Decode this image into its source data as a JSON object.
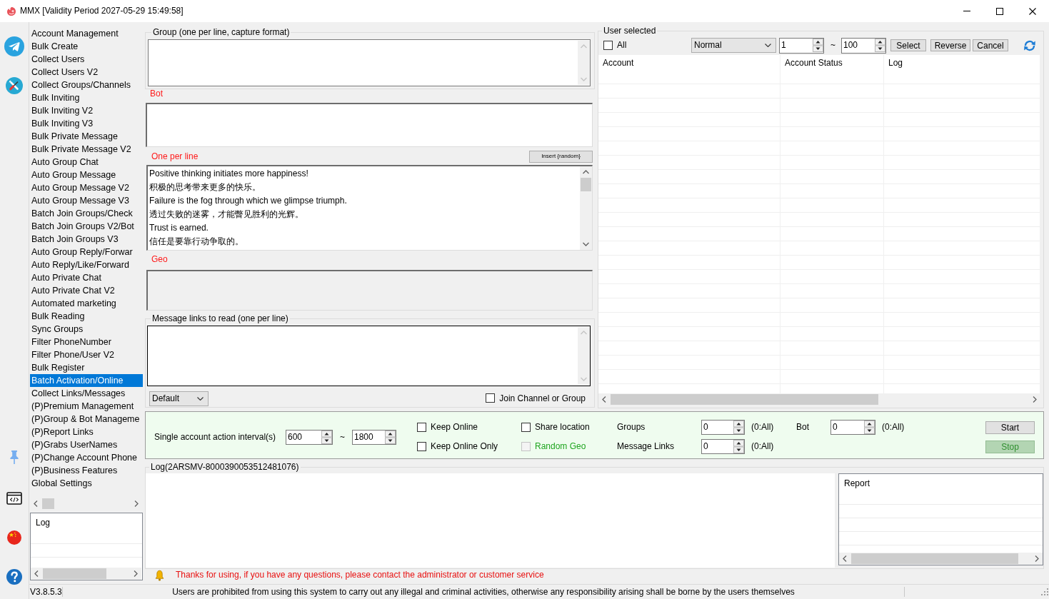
{
  "window": {
    "title": "MMX [Validity Period 2027-05-29 15:49:58]"
  },
  "menu": {
    "items": [
      {
        "label": "Account Management",
        "selected": false
      },
      {
        "label": "Bulk Create",
        "selected": false
      },
      {
        "label": "Collect Users",
        "selected": false
      },
      {
        "label": "Collect Users V2",
        "selected": false
      },
      {
        "label": "Collect Groups/Channels",
        "selected": false
      },
      {
        "label": "Bulk Inviting",
        "selected": false
      },
      {
        "label": "Bulk Inviting V2",
        "selected": false
      },
      {
        "label": "Bulk Inviting V3",
        "selected": false
      },
      {
        "label": "Bulk Private Message",
        "selected": false
      },
      {
        "label": "Bulk Private Message V2",
        "selected": false
      },
      {
        "label": "Auto Group Chat",
        "selected": false
      },
      {
        "label": "Auto Group Message",
        "selected": false
      },
      {
        "label": "Auto Group Message V2",
        "selected": false
      },
      {
        "label": "Auto Group Message V3",
        "selected": false
      },
      {
        "label": "Batch Join Groups/Check",
        "selected": false
      },
      {
        "label": "Batch Join Groups V2/Bot",
        "selected": false
      },
      {
        "label": "Batch Join Groups V3",
        "selected": false
      },
      {
        "label": "Auto Group Reply/Forwar",
        "selected": false
      },
      {
        "label": "Auto Reply/Like/Forward",
        "selected": false
      },
      {
        "label": "Auto Private Chat",
        "selected": false
      },
      {
        "label": "Auto Private Chat V2",
        "selected": false
      },
      {
        "label": "Automated marketing",
        "selected": false
      },
      {
        "label": "Bulk Reading",
        "selected": false
      },
      {
        "label": "Sync Groups",
        "selected": false
      },
      {
        "label": "Filter PhoneNumber",
        "selected": false
      },
      {
        "label": "Filter Phone/User V2",
        "selected": false
      },
      {
        "label": "Bulk Register",
        "selected": false
      },
      {
        "label": "Batch Activation/Online",
        "selected": true
      },
      {
        "label": "Collect Links/Messages",
        "selected": false
      },
      {
        "label": "(P)Premium Management",
        "selected": false
      },
      {
        "label": "(P)Group & Bot Manageme",
        "selected": false
      },
      {
        "label": "(P)Report Links",
        "selected": false
      },
      {
        "label": "(P)Grabs UserNames",
        "selected": false
      },
      {
        "label": "(P)Change Account Phone",
        "selected": false
      },
      {
        "label": "(P)Business Features",
        "selected": false
      },
      {
        "label": "Global Settings",
        "selected": false
      }
    ]
  },
  "side_log": {
    "header": "Log"
  },
  "group_input": {
    "legend": "Group (one per line, capture format)"
  },
  "bot": {
    "label": "Bot"
  },
  "messages": {
    "label": "One per line",
    "insert_button": "Insert {random}",
    "lines": [
      "Positive thinking initiates more happiness!",
      "积极的思考带来更多的快乐。",
      "Failure is the fog through which we glimpse triumph.",
      "透过失败的迷雾，才能瞥见胜利的光辉。",
      "Trust is earned.",
      "信任是要靠行动争取的。"
    ]
  },
  "geo": {
    "label": "Geo",
    "disabled": true
  },
  "message_links": {
    "legend": "Message links to read (one per line)",
    "mode": "Default",
    "join_channel": {
      "label": "Join Channel or Group",
      "checked": false
    }
  },
  "user_selected": {
    "legend": "User selected",
    "select_all": {
      "label": "All",
      "checked": false
    },
    "filter": "Normal",
    "range_from": "1",
    "range_separator": "~",
    "range_to": "100",
    "buttons": [
      "Select",
      "Reverse",
      "Cancel"
    ],
    "columns": [
      "Account",
      "Account Status",
      "Log"
    ]
  },
  "settings": {
    "interval_label": "Single account action interval(s)",
    "interval_min": "600",
    "interval_separator": "~",
    "interval_max": "1800",
    "options": [
      {
        "label": "Keep Online",
        "checked": false,
        "disabled": false
      },
      {
        "label": "Keep Online Only",
        "checked": false,
        "disabled": false
      },
      {
        "label": "Share location",
        "checked": false,
        "disabled": false
      },
      {
        "label": "Random Geo",
        "checked": false,
        "disabled": true
      }
    ],
    "limits": [
      {
        "label": "Groups",
        "value": "0",
        "hint": "(0:All)"
      },
      {
        "label": "Message Links",
        "value": "0",
        "hint": "(0:All)"
      },
      {
        "label": "Bot",
        "value": "0",
        "hint": "(0:All)"
      }
    ],
    "actions": [
      {
        "label": "Start",
        "disabled": false
      },
      {
        "label": "Stop",
        "disabled": true
      }
    ]
  },
  "log": {
    "legend": "Log(2ARSMV-8000390053512481076)",
    "report_header": "Report"
  },
  "notice": "Thanks for using, if you have any questions, please contact the administrator or customer service",
  "status_bar": {
    "version": "V3.8.5.3",
    "message": "Users are prohibited from using this system to carry out any illegal and criminal activities, otherwise any responsibility arising shall be borne by the users themselves"
  }
}
